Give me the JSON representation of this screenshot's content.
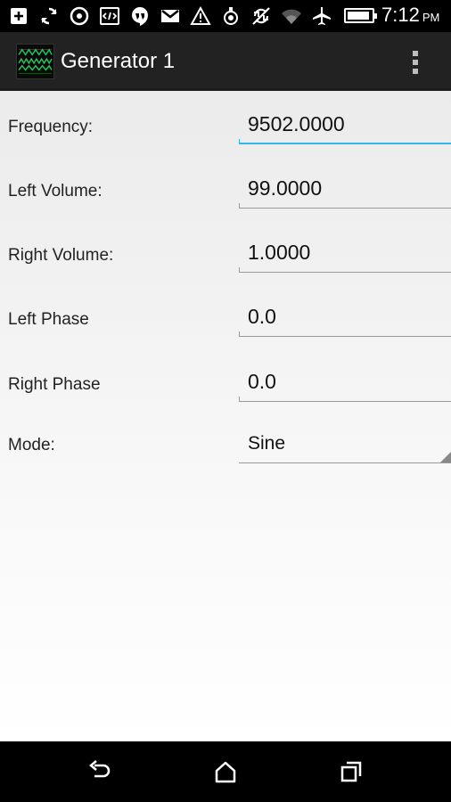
{
  "status_bar": {
    "icons": [
      "add-box-icon",
      "sync-icon",
      "target-icon",
      "code-icon",
      "hangouts-icon",
      "gmail-icon",
      "warning-icon",
      "hand-icon",
      "no-sync-icon",
      "wifi-icon",
      "airplane-icon",
      "battery-icon"
    ],
    "time": "7:12",
    "ampm": "PM"
  },
  "action_bar": {
    "title": "Generator 1",
    "icon": "waveform-icon",
    "menu_icon": "overflow-menu-icon"
  },
  "fields": [
    {
      "label": "Frequency:",
      "value": "9502.0000",
      "focused": true
    },
    {
      "label": "Left Volume:",
      "value": "99.0000"
    },
    {
      "label": "Right Volume:",
      "value": "1.0000"
    },
    {
      "label": "Left Phase",
      "value": "0.0"
    },
    {
      "label": "Right Phase",
      "value": "0.0"
    }
  ],
  "mode": {
    "label": "Mode:",
    "value": "Sine"
  },
  "nav_bar": {
    "back": "back-icon",
    "home": "home-icon",
    "recents": "recents-icon"
  },
  "colors": {
    "focus_accent": "#33b5e5",
    "action_bar": "#222222",
    "waveform": "#22c55e"
  }
}
